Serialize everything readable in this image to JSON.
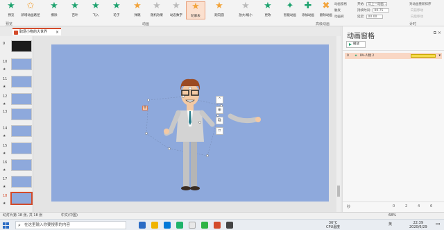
{
  "ribbon": {
    "buttons": [
      {
        "label": "预览"
      },
      {
        "label": "新增动画路径"
      },
      {
        "label": "擦除"
      },
      {
        "label": "百叶"
      },
      {
        "label": "飞入"
      },
      {
        "label": "轮子"
      },
      {
        "label": "弹跳"
      },
      {
        "label": "随机效果"
      },
      {
        "label": "动态数字"
      },
      {
        "label": "轮廓表"
      },
      {
        "label": "跑向圆"
      },
      {
        "label": "放大/缩小"
      },
      {
        "label": "更改"
      },
      {
        "label": "智能动画"
      },
      {
        "label": "添加动画"
      },
      {
        "label": "删除动画"
      },
      {
        "label": "动画刷"
      }
    ],
    "selected_index": 10,
    "groups": [
      {
        "label": "预览"
      },
      {
        "label": "动画"
      },
      {
        "label": "高级动画"
      },
      {
        "label": "计时"
      }
    ],
    "timing": {
      "start_label": "开始:",
      "start_value": "与上一动画...",
      "duration_label": "持续时间:",
      "duration_value": "00.75",
      "delay_label": "延迟:",
      "delay_value": "00.00",
      "reorder_label": "对动画重新排序",
      "move_earlier": "向前移动",
      "move_later": "向后移动",
      "anim_pane": "动画窗格",
      "trigger": "触发",
      "anim_painter": "动画刷"
    }
  },
  "doc_tab": {
    "title": "职场小物的大世界"
  },
  "thumbnails": [
    {
      "num": "9",
      "star": "",
      "dark": true
    },
    {
      "num": "10",
      "star": "★",
      "dark": false
    },
    {
      "num": "11",
      "star": "★",
      "dark": false
    },
    {
      "num": "12",
      "star": "★",
      "dark": false
    },
    {
      "num": "13",
      "star": "",
      "dark": false
    },
    {
      "num": "14",
      "star": "★",
      "dark": false
    },
    {
      "num": "15",
      "star": "★",
      "dark": false
    },
    {
      "num": "16",
      "star": "★",
      "dark": false
    },
    {
      "num": "17",
      "star": "★",
      "dark": false
    },
    {
      "num": "18",
      "star": "★",
      "dark": false
    }
  ],
  "slide": {
    "tag": "0"
  },
  "pane": {
    "title": "动画窗格",
    "play_label": "播放",
    "row": {
      "index": "0",
      "name": "PA-人物 2"
    },
    "bottom": {
      "page_label": "秒",
      "n0": "0",
      "n2": "2",
      "n4": "4",
      "n6": "6"
    }
  },
  "status": {
    "slide_info": "幻灯片第 18 张, 共 18 张",
    "lang": "中文(中国)",
    "zoom": "68%"
  },
  "taskbar": {
    "search_placeholder": "在这里输入你要搜索的内容",
    "temp": "36°C",
    "cpu": "CPU温度",
    "time": "22:39",
    "date": "2020/6/29",
    "ime": "英"
  },
  "colors": {
    "accent": "#d34b2b",
    "slide_bg": "#8ea9dc",
    "anim_bar": "#f5d94a"
  }
}
